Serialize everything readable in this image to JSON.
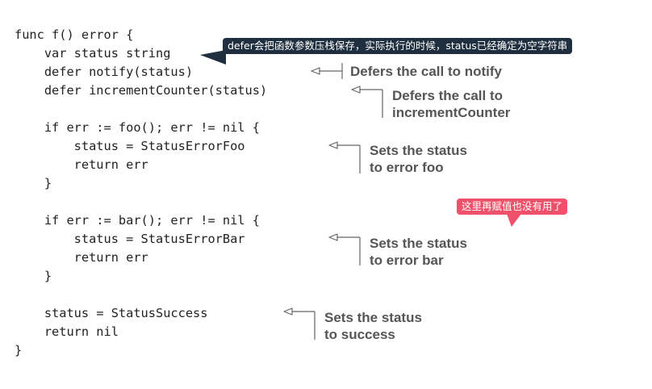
{
  "code_lines": [
    "func f() error {",
    "    var status string",
    "    defer notify(status)",
    "    defer incrementCounter(status)",
    "",
    "    if err := foo(); err != nil {",
    "        status = StatusErrorFoo",
    "        return err",
    "    }",
    "",
    "    if err := bar(); err != nil {",
    "        status = StatusErrorBar",
    "        return err",
    "    }",
    "",
    "    status = StatusSuccess",
    "    return nil",
    "}"
  ],
  "annotations": {
    "defer_notify": "Defers the call to notify",
    "defer_increment_1": "Defers the call to",
    "defer_increment_2": "incrementCounter",
    "error_foo_1": "Sets the status",
    "error_foo_2": "to error foo",
    "error_bar_1": "Sets the status",
    "error_bar_2": "to error bar",
    "success_1": "Sets the status",
    "success_2": "to success"
  },
  "callouts": {
    "defer_note": "defer会把函数参数压栈保存，实际执行的时候，status已经确定为空字符串",
    "useless_note": "这里再赋值也没有用了"
  },
  "colors": {
    "code": "#222222",
    "annotation": "#555555",
    "dark_callout": "#1f2f3f",
    "red_callout": "#f0516a"
  }
}
